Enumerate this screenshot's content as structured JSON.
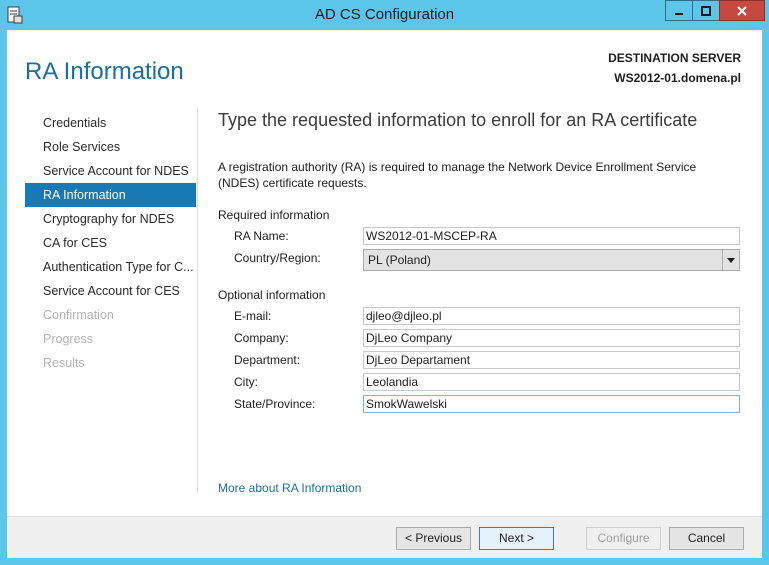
{
  "window": {
    "title": "AD CS Configuration"
  },
  "header": {
    "page_title": "RA Information",
    "destination_label": "DESTINATION SERVER",
    "destination_server": "WS2012-01.domena.pl"
  },
  "nav": {
    "items": [
      {
        "label": "Credentials",
        "state": "normal"
      },
      {
        "label": "Role Services",
        "state": "normal"
      },
      {
        "label": "Service Account for NDES",
        "state": "normal"
      },
      {
        "label": "RA Information",
        "state": "active"
      },
      {
        "label": "Cryptography for NDES",
        "state": "normal"
      },
      {
        "label": "CA for CES",
        "state": "normal"
      },
      {
        "label": "Authentication Type for C...",
        "state": "normal"
      },
      {
        "label": "Service Account for CES",
        "state": "normal"
      },
      {
        "label": "Confirmation",
        "state": "disabled"
      },
      {
        "label": "Progress",
        "state": "disabled"
      },
      {
        "label": "Results",
        "state": "disabled"
      }
    ]
  },
  "main": {
    "heading": "Type the requested information to enroll for an RA certificate",
    "description": "A registration authority (RA) is required to manage the Network Device Enrollment Service (NDES) certificate requests.",
    "required_section": "Required information",
    "ra_name_label": "RA Name:",
    "ra_name_value": "WS2012-01-MSCEP-RA",
    "country_label": "Country/Region:",
    "country_value": "PL (Poland)",
    "optional_section": "Optional information",
    "email_label": "E-mail:",
    "email_value": "djleo@djleo.pl",
    "company_label": "Company:",
    "company_value": "DjLeo Company",
    "department_label": "Department:",
    "department_value": "DjLeo Departament",
    "city_label": "City:",
    "city_value": "Leolandia",
    "state_label": "State/Province:",
    "state_value": "SmokWawelski",
    "more_link": "More about RA Information"
  },
  "footer": {
    "previous": "< Previous",
    "next": "Next >",
    "configure": "Configure",
    "cancel": "Cancel"
  },
  "colors": {
    "frame": "#5bc5ea",
    "accent": "#1979b5",
    "close": "#c7483e"
  }
}
